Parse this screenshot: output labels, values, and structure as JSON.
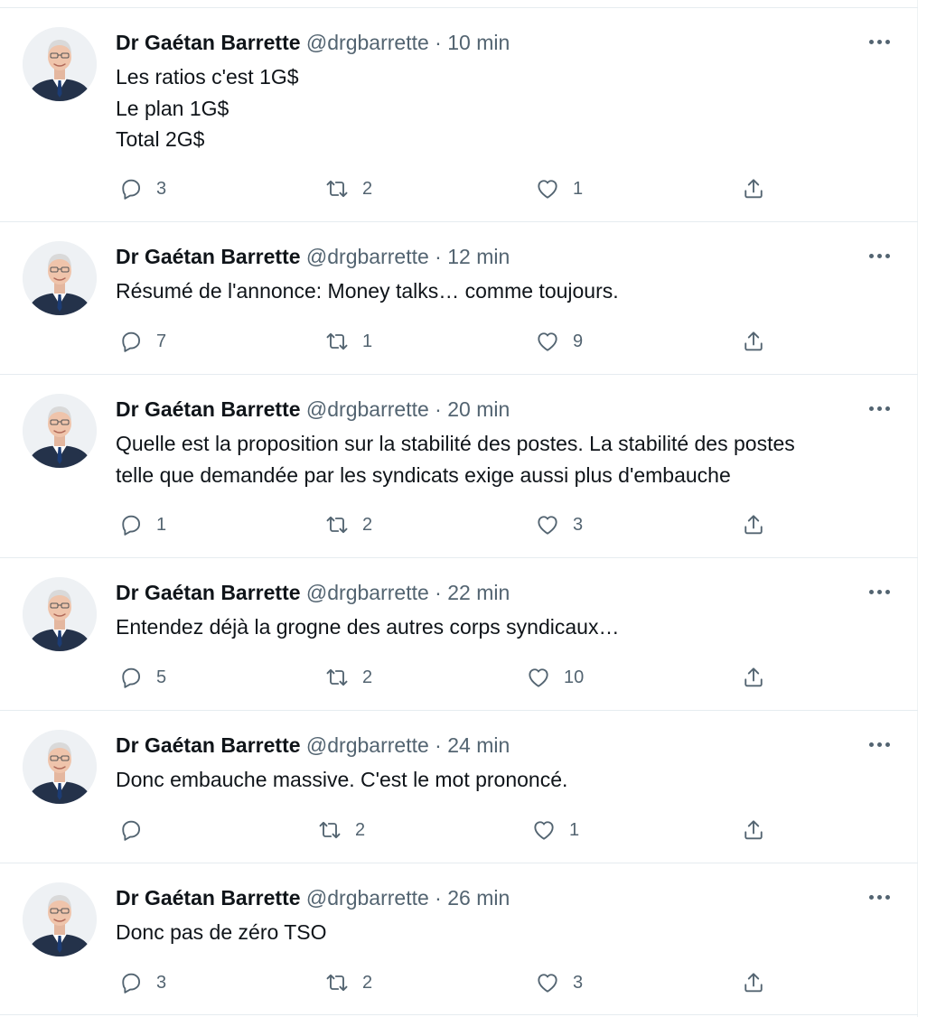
{
  "author": {
    "name": "Dr Gaétan Barrette",
    "handle": "@drgbarrette",
    "separator": "·"
  },
  "colors": {
    "text": "#0f1419",
    "secondary": "#536471",
    "divider": "#e6ecf0"
  },
  "icons": {
    "reply": "reply-icon",
    "retweet": "retweet-icon",
    "like": "heart-icon",
    "share": "share-icon",
    "more": "more-icon"
  },
  "tweets": [
    {
      "time": "10 min",
      "lines": [
        "Les ratios c'est 1G$",
        "Le plan 1G$",
        "Total 2G$"
      ],
      "replies": "3",
      "retweets": "2",
      "likes": "1"
    },
    {
      "time": "12 min",
      "lines": [
        "Résumé de l'annonce: Money talks… comme toujours."
      ],
      "replies": "7",
      "retweets": "1",
      "likes": "9"
    },
    {
      "time": "20 min",
      "lines": [
        "Quelle est la proposition sur la stabilité des postes. La stabilité des postes",
        "telle que demandée par les syndicats exige aussi plus d'embauche"
      ],
      "replies": "1",
      "retweets": "2",
      "likes": "3"
    },
    {
      "time": "22 min",
      "lines": [
        "Entendez déjà la grogne des autres corps syndicaux…"
      ],
      "replies": "5",
      "retweets": "2",
      "likes": "10"
    },
    {
      "time": "24 min",
      "lines": [
        "Donc embauche massive. C'est le mot prononcé."
      ],
      "replies": "",
      "retweets": "2",
      "likes": "1"
    },
    {
      "time": "26 min",
      "lines": [
        "Donc pas de zéro TSO"
      ],
      "replies": "3",
      "retweets": "2",
      "likes": "3"
    }
  ]
}
